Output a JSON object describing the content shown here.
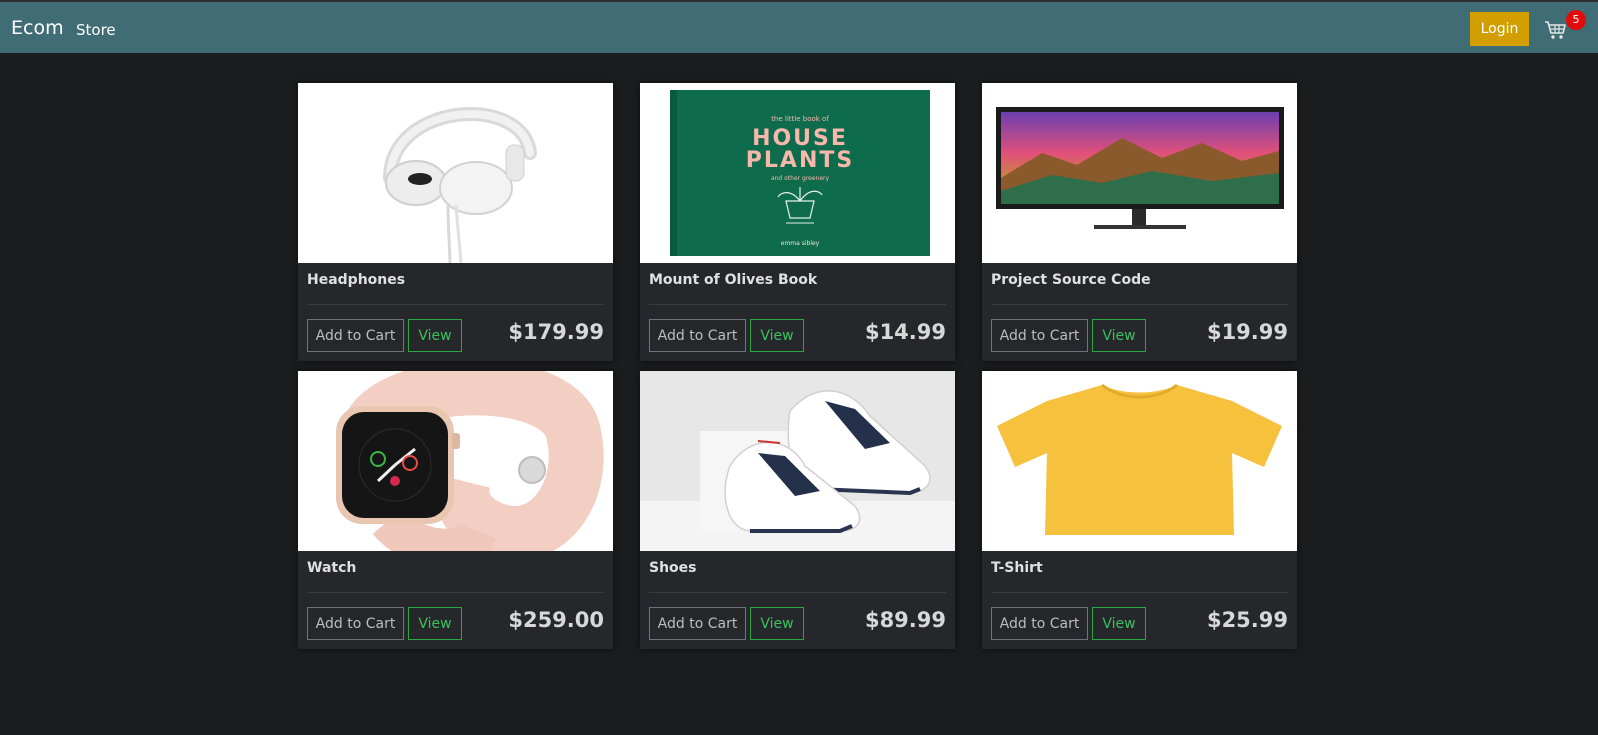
{
  "navbar": {
    "brand": "Ecom",
    "store_link": "Store",
    "login_label": "Login",
    "cart_count": "5",
    "colors": {
      "bar": "#406c75",
      "login": "#d39e00",
      "badge": "#e10b0b"
    }
  },
  "products": [
    {
      "name": "Headphones",
      "price": "$179.99",
      "image": "headphones-image",
      "add_label": "Add to Cart",
      "view_label": "View"
    },
    {
      "name": "Mount of Olives Book",
      "price": "$14.99",
      "image": "book-image",
      "add_label": "Add to Cart",
      "view_label": "View",
      "image_text": {
        "top": "the little book of",
        "line1": "HOUSE",
        "line2": "PLANTS",
        "sub": "and other greenery",
        "author": "emma sibley"
      }
    },
    {
      "name": "Project Source Code",
      "price": "$19.99",
      "image": "monitor-image",
      "add_label": "Add to Cart",
      "view_label": "View"
    },
    {
      "name": "Watch",
      "price": "$259.00",
      "image": "watch-image",
      "add_label": "Add to Cart",
      "view_label": "View"
    },
    {
      "name": "Shoes",
      "price": "$89.99",
      "image": "shoes-image",
      "add_label": "Add to Cart",
      "view_label": "View"
    },
    {
      "name": "T-Shirt",
      "price": "$25.99",
      "image": "tshirt-image",
      "add_label": "Add to Cart",
      "view_label": "View"
    }
  ]
}
